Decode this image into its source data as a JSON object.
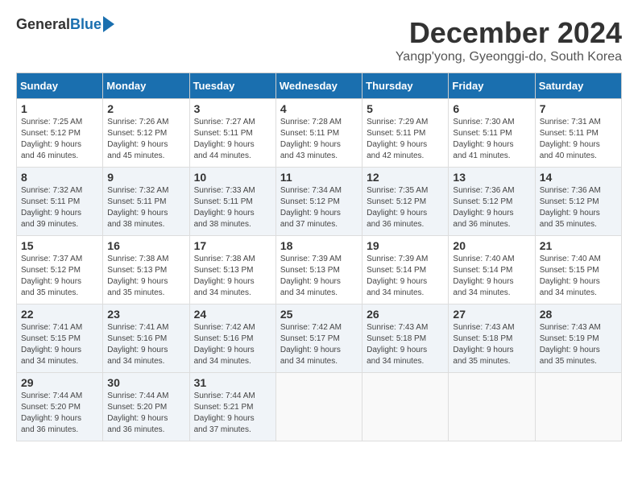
{
  "logo": {
    "general": "General",
    "blue": "Blue"
  },
  "title": "December 2024",
  "subtitle": "Yangp'yong, Gyeonggi-do, South Korea",
  "days_header": [
    "Sunday",
    "Monday",
    "Tuesday",
    "Wednesday",
    "Thursday",
    "Friday",
    "Saturday"
  ],
  "weeks": [
    [
      {
        "day": "1",
        "info": "Sunrise: 7:25 AM\nSunset: 5:12 PM\nDaylight: 9 hours\nand 46 minutes."
      },
      {
        "day": "2",
        "info": "Sunrise: 7:26 AM\nSunset: 5:12 PM\nDaylight: 9 hours\nand 45 minutes."
      },
      {
        "day": "3",
        "info": "Sunrise: 7:27 AM\nSunset: 5:11 PM\nDaylight: 9 hours\nand 44 minutes."
      },
      {
        "day": "4",
        "info": "Sunrise: 7:28 AM\nSunset: 5:11 PM\nDaylight: 9 hours\nand 43 minutes."
      },
      {
        "day": "5",
        "info": "Sunrise: 7:29 AM\nSunset: 5:11 PM\nDaylight: 9 hours\nand 42 minutes."
      },
      {
        "day": "6",
        "info": "Sunrise: 7:30 AM\nSunset: 5:11 PM\nDaylight: 9 hours\nand 41 minutes."
      },
      {
        "day": "7",
        "info": "Sunrise: 7:31 AM\nSunset: 5:11 PM\nDaylight: 9 hours\nand 40 minutes."
      }
    ],
    [
      {
        "day": "8",
        "info": "Sunrise: 7:32 AM\nSunset: 5:11 PM\nDaylight: 9 hours\nand 39 minutes."
      },
      {
        "day": "9",
        "info": "Sunrise: 7:32 AM\nSunset: 5:11 PM\nDaylight: 9 hours\nand 38 minutes."
      },
      {
        "day": "10",
        "info": "Sunrise: 7:33 AM\nSunset: 5:11 PM\nDaylight: 9 hours\nand 38 minutes."
      },
      {
        "day": "11",
        "info": "Sunrise: 7:34 AM\nSunset: 5:12 PM\nDaylight: 9 hours\nand 37 minutes."
      },
      {
        "day": "12",
        "info": "Sunrise: 7:35 AM\nSunset: 5:12 PM\nDaylight: 9 hours\nand 36 minutes."
      },
      {
        "day": "13",
        "info": "Sunrise: 7:36 AM\nSunset: 5:12 PM\nDaylight: 9 hours\nand 36 minutes."
      },
      {
        "day": "14",
        "info": "Sunrise: 7:36 AM\nSunset: 5:12 PM\nDaylight: 9 hours\nand 35 minutes."
      }
    ],
    [
      {
        "day": "15",
        "info": "Sunrise: 7:37 AM\nSunset: 5:12 PM\nDaylight: 9 hours\nand 35 minutes."
      },
      {
        "day": "16",
        "info": "Sunrise: 7:38 AM\nSunset: 5:13 PM\nDaylight: 9 hours\nand 35 minutes."
      },
      {
        "day": "17",
        "info": "Sunrise: 7:38 AM\nSunset: 5:13 PM\nDaylight: 9 hours\nand 34 minutes."
      },
      {
        "day": "18",
        "info": "Sunrise: 7:39 AM\nSunset: 5:13 PM\nDaylight: 9 hours\nand 34 minutes."
      },
      {
        "day": "19",
        "info": "Sunrise: 7:39 AM\nSunset: 5:14 PM\nDaylight: 9 hours\nand 34 minutes."
      },
      {
        "day": "20",
        "info": "Sunrise: 7:40 AM\nSunset: 5:14 PM\nDaylight: 9 hours\nand 34 minutes."
      },
      {
        "day": "21",
        "info": "Sunrise: 7:40 AM\nSunset: 5:15 PM\nDaylight: 9 hours\nand 34 minutes."
      }
    ],
    [
      {
        "day": "22",
        "info": "Sunrise: 7:41 AM\nSunset: 5:15 PM\nDaylight: 9 hours\nand 34 minutes."
      },
      {
        "day": "23",
        "info": "Sunrise: 7:41 AM\nSunset: 5:16 PM\nDaylight: 9 hours\nand 34 minutes."
      },
      {
        "day": "24",
        "info": "Sunrise: 7:42 AM\nSunset: 5:16 PM\nDaylight: 9 hours\nand 34 minutes."
      },
      {
        "day": "25",
        "info": "Sunrise: 7:42 AM\nSunset: 5:17 PM\nDaylight: 9 hours\nand 34 minutes."
      },
      {
        "day": "26",
        "info": "Sunrise: 7:43 AM\nSunset: 5:18 PM\nDaylight: 9 hours\nand 34 minutes."
      },
      {
        "day": "27",
        "info": "Sunrise: 7:43 AM\nSunset: 5:18 PM\nDaylight: 9 hours\nand 35 minutes."
      },
      {
        "day": "28",
        "info": "Sunrise: 7:43 AM\nSunset: 5:19 PM\nDaylight: 9 hours\nand 35 minutes."
      }
    ],
    [
      {
        "day": "29",
        "info": "Sunrise: 7:44 AM\nSunset: 5:20 PM\nDaylight: 9 hours\nand 36 minutes."
      },
      {
        "day": "30",
        "info": "Sunrise: 7:44 AM\nSunset: 5:20 PM\nDaylight: 9 hours\nand 36 minutes."
      },
      {
        "day": "31",
        "info": "Sunrise: 7:44 AM\nSunset: 5:21 PM\nDaylight: 9 hours\nand 37 minutes."
      },
      {
        "day": "",
        "info": ""
      },
      {
        "day": "",
        "info": ""
      },
      {
        "day": "",
        "info": ""
      },
      {
        "day": "",
        "info": ""
      }
    ]
  ]
}
